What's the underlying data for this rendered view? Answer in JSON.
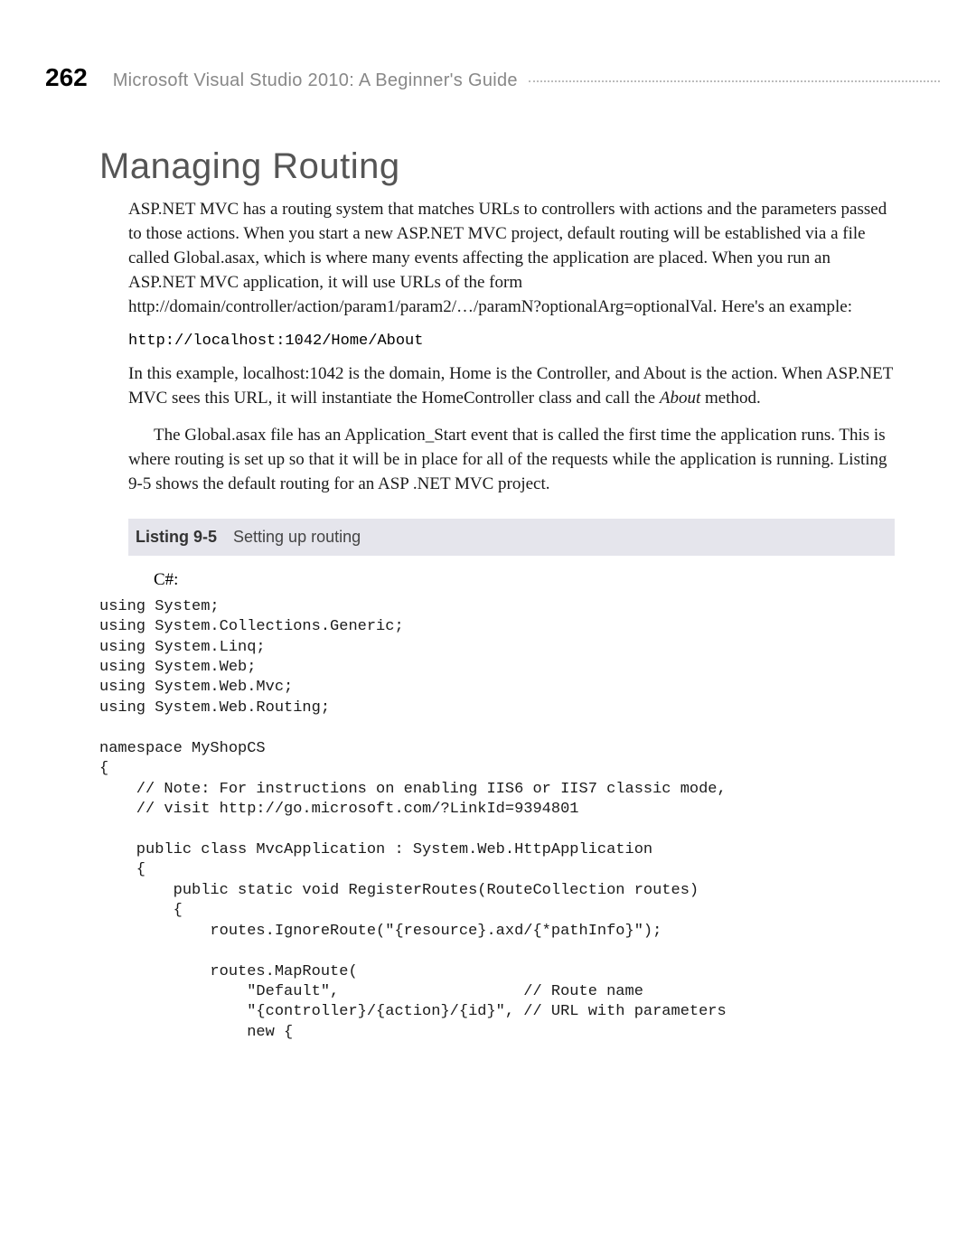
{
  "header": {
    "page_number": "262",
    "book_title": "Microsoft Visual Studio 2010: A Beginner's Guide"
  },
  "section": {
    "title": "Managing Routing",
    "para1": "ASP.NET MVC has a routing system that matches URLs to controllers with actions and the parameters passed to those actions. When you start a new ASP.NET MVC project, default routing will be established via a file called Global.asax, which is where many events affecting the application are placed. When you run an ASP.NET MVC application, it will use URLs of the form http://domain/controller/action/param1/param2/…/paramN?optionalArg=optionalVal. Here's an example:",
    "code_url": "http://localhost:1042/Home/About",
    "para2_a": "In this example, localhost:1042 is the domain, Home is the Controller, and About is the action. When ASP.NET MVC sees this URL, it will instantiate the HomeController class and call the ",
    "para2_italic": "About",
    "para2_b": " method.",
    "para3": "The Global.asax file has an Application_Start event that is called the first time the application runs. This is where routing is set up so that it will be in place for all of the requests while the application is running. Listing 9-5 shows the default routing for an ASP .NET MVC project."
  },
  "listing": {
    "label": "Listing 9-5",
    "caption": "Setting up routing",
    "lang": "C#:",
    "code": "using System;\nusing System.Collections.Generic;\nusing System.Linq;\nusing System.Web;\nusing System.Web.Mvc;\nusing System.Web.Routing;\n\nnamespace MyShopCS\n{\n    // Note: For instructions on enabling IIS6 or IIS7 classic mode,\n    // visit http://go.microsoft.com/?LinkId=9394801\n\n    public class MvcApplication : System.Web.HttpApplication\n    {\n        public static void RegisterRoutes(RouteCollection routes)\n        {\n            routes.IgnoreRoute(\"{resource}.axd/{*pathInfo}\");\n\n            routes.MapRoute(\n                \"Default\",                    // Route name\n                \"{controller}/{action}/{id}\", // URL with parameters\n                new {"
  }
}
